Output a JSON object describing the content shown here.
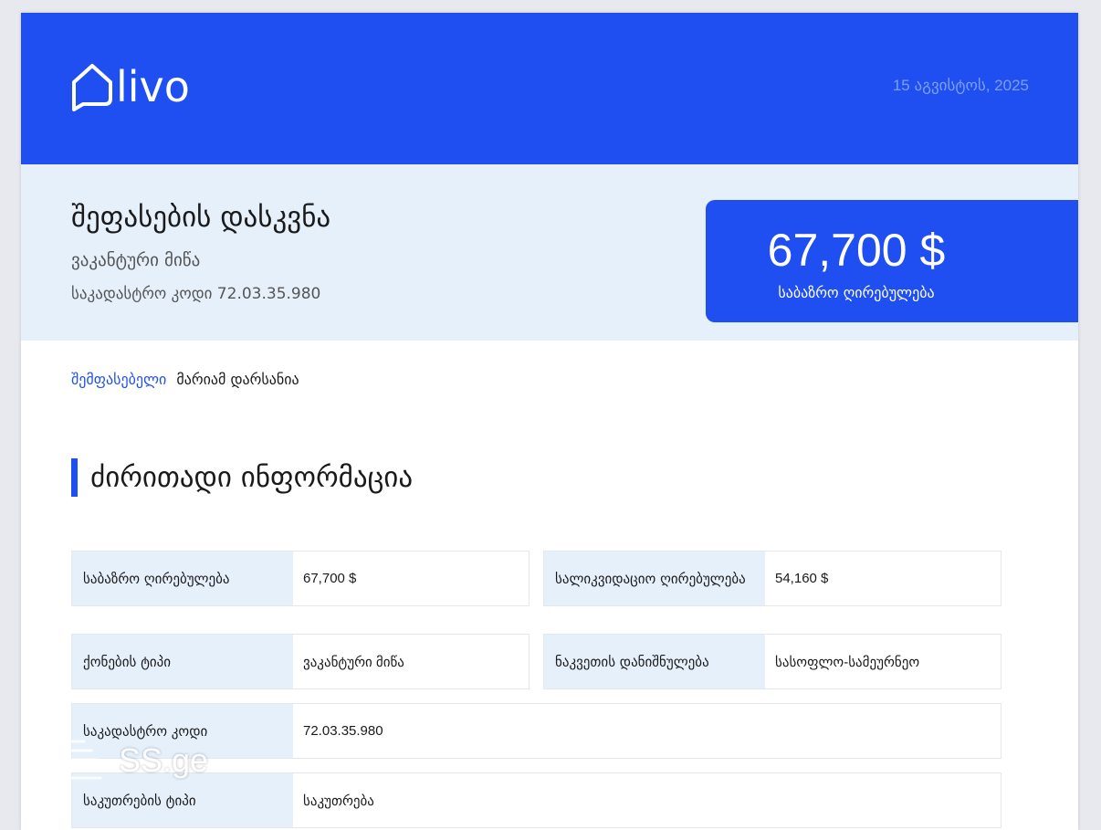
{
  "header": {
    "logo_text": "livo",
    "date": "15 აგვისტოს, 2025"
  },
  "summary": {
    "title": "შეფასების დასკვნა",
    "property_type": "ვაკანტური მიწა",
    "cadastral": "საკადასტრო კოდი 72.03.35.980",
    "value": "67,700 $",
    "value_label": "საბაზრო ღირებულება"
  },
  "appraiser": {
    "label": "შემფასებელი",
    "name": "მარიამ დარსანია"
  },
  "section": {
    "title": "ძირითადი ინფორმაცია"
  },
  "info": [
    {
      "label": "საბაზრო ღირებულება",
      "value": "67,700 $"
    },
    {
      "label": "სალიკვიდაციო ღირებულება",
      "value": "54,160 $"
    },
    {
      "label": "ქონების ტიპი",
      "value": "ვაკანტური მიწა"
    },
    {
      "label": "ნაკვეთის დანიშნულება",
      "value": "სასოფლო-სამეურნეო"
    },
    {
      "label": "საკადასტრო კოდი",
      "value": "72.03.35.980"
    },
    {
      "label": "საკუთრების ტიპი",
      "value": "საკუთრება"
    }
  ],
  "watermark": {
    "text": "SS.ge",
    "icon": "ss-lines-icon"
  },
  "colors": {
    "accent": "#1f4ff0",
    "light_panel": "#e6f0fb",
    "date_text": "#7f9ff7"
  }
}
